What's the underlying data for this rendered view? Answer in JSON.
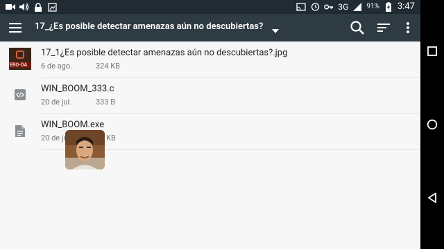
{
  "status_bar": {
    "network": "3G",
    "battery": "91%",
    "time": "3:47"
  },
  "app_bar": {
    "title": "17_¿Es posible detectar amenazas aún no descubiertas?"
  },
  "files": [
    {
      "name": "17_1¿Es posible detectar amenazas aún no descubiertas?.jpg",
      "date": "6 de ago.",
      "size": "324 KB",
      "icon": "image-thumbnail",
      "thumb_text": "ERO-DA"
    },
    {
      "name": "WIN_BOOM_333.c",
      "date": "20 de jul.",
      "size": "333 B",
      "icon": "code-file-icon"
    },
    {
      "name": "WIN_BOOM.exe",
      "date": "20 de jul.",
      "size": "30 KB",
      "icon": "document-icon"
    }
  ]
}
